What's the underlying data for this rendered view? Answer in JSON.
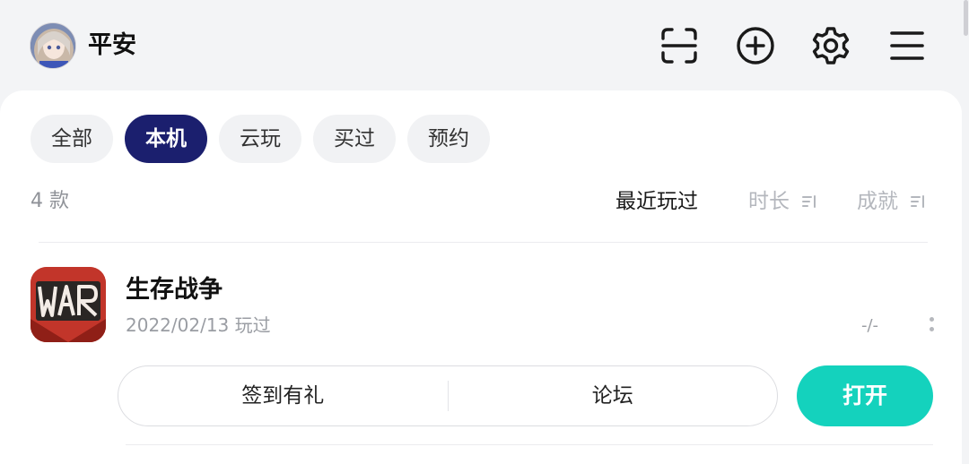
{
  "header": {
    "username": "平安",
    "icons": [
      "scan-icon",
      "add-circle-icon",
      "gear-icon",
      "menu-icon"
    ]
  },
  "tabs": [
    {
      "label": "全部",
      "active": false
    },
    {
      "label": "本机",
      "active": true
    },
    {
      "label": "云玩",
      "active": false
    },
    {
      "label": "买过",
      "active": false
    },
    {
      "label": "预约",
      "active": false
    }
  ],
  "list": {
    "count": "4 款",
    "sort": {
      "recent": "最近玩过",
      "duration": "时长",
      "achievement": "成就"
    }
  },
  "games": [
    {
      "icon_text": "WAR",
      "title": "生存战争",
      "meta": "2022/02/13 玩过",
      "progress": "-/-",
      "actions": [
        "签到有礼",
        "论坛"
      ],
      "open_label": "打开"
    }
  ],
  "colors": {
    "accent": "#1b1f6e",
    "open_button": "#14d2bd",
    "game_icon_bg": "#c2352a"
  }
}
